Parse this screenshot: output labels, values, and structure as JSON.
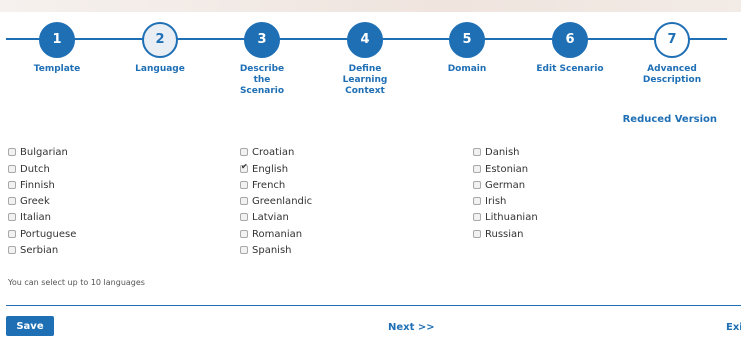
{
  "steps": [
    {
      "number": "1",
      "label": "Template"
    },
    {
      "number": "2",
      "label": "Language"
    },
    {
      "number": "3",
      "label": "Describe the Scenario"
    },
    {
      "number": "4",
      "label": "Define Learning Context"
    },
    {
      "number": "5",
      "label": "Domain"
    },
    {
      "number": "6",
      "label": "Edit Scenario"
    },
    {
      "number": "7",
      "label": "Advanced Description"
    }
  ],
  "reduced_version_label": "Reduced Version",
  "languages": [
    {
      "label": "Bulgarian",
      "checked": false
    },
    {
      "label": "Croatian",
      "checked": false
    },
    {
      "label": "Danish",
      "checked": false
    },
    {
      "label": "Dutch",
      "checked": false
    },
    {
      "label": "English",
      "checked": true
    },
    {
      "label": "Estonian",
      "checked": false
    },
    {
      "label": "Finnish",
      "checked": false
    },
    {
      "label": "French",
      "checked": false
    },
    {
      "label": "German",
      "checked": false
    },
    {
      "label": "Greek",
      "checked": false
    },
    {
      "label": "Greenlandic",
      "checked": false
    },
    {
      "label": "Irish",
      "checked": false
    },
    {
      "label": "Italian",
      "checked": false
    },
    {
      "label": "Latvian",
      "checked": false
    },
    {
      "label": "Lithuanian",
      "checked": false
    },
    {
      "label": "Portuguese",
      "checked": false
    },
    {
      "label": "Romanian",
      "checked": false
    },
    {
      "label": "Russian",
      "checked": false
    },
    {
      "label": "Serbian",
      "checked": false
    },
    {
      "label": "Spanish",
      "checked": false
    }
  ],
  "hint": "You can select up to 10 languages",
  "footer": {
    "save_label": "Save",
    "next_label": "Next >>",
    "exit_label": "Exi"
  }
}
